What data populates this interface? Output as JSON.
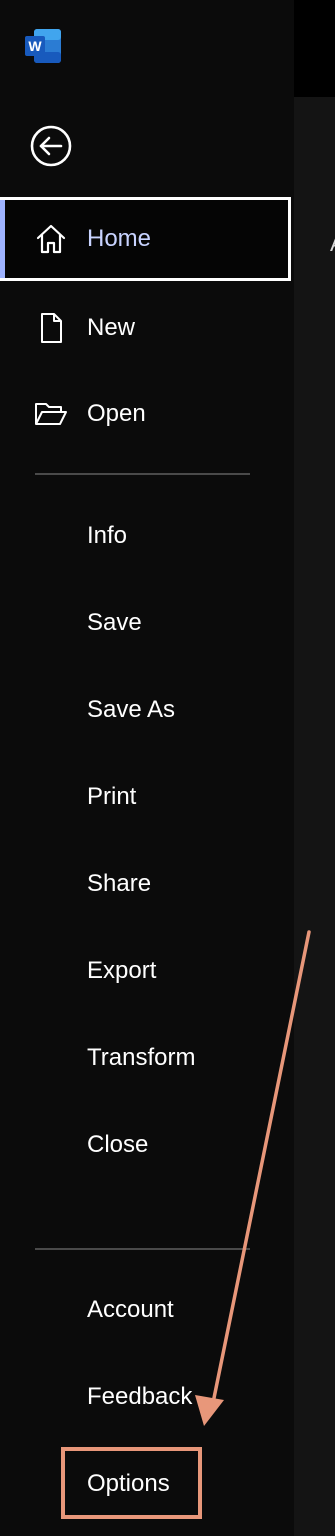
{
  "app": {
    "logo_icon": "word-logo-icon",
    "accent_color": "#9fb3ff",
    "highlight_color": "#e8977a"
  },
  "back": {
    "icon": "back-arrow-circle-icon"
  },
  "nav": {
    "home": {
      "label": "Home",
      "icon": "home-icon"
    },
    "new": {
      "label": "New",
      "icon": "new-document-icon"
    },
    "open": {
      "label": "Open",
      "icon": "folder-open-icon"
    },
    "info": {
      "label": "Info"
    },
    "save": {
      "label": "Save"
    },
    "save_as": {
      "label": "Save As"
    },
    "print": {
      "label": "Print"
    },
    "share": {
      "label": "Share"
    },
    "export": {
      "label": "Export"
    },
    "transform": {
      "label": "Transform"
    },
    "close": {
      "label": "Close"
    },
    "account": {
      "label": "Account"
    },
    "feedback": {
      "label": "Feedback"
    },
    "options": {
      "label": "Options"
    }
  },
  "main": {
    "partial_char": "A"
  }
}
